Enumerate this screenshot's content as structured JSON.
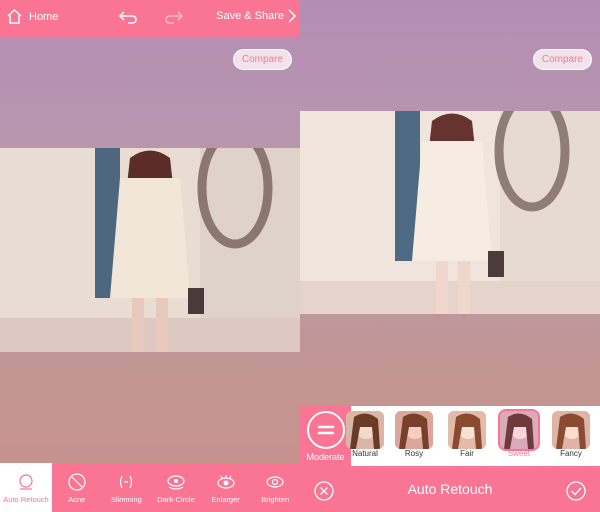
{
  "left": {
    "topbar": {
      "home_label": "Home",
      "share_label": "Save & Share"
    },
    "compare_label": "Compare",
    "toolbar": {
      "items": [
        {
          "label": "Auto Retouch",
          "icon": "auto-retouch-icon",
          "active": true
        },
        {
          "label": "Acne",
          "icon": "acne-icon"
        },
        {
          "label": "Slimming",
          "icon": "slimming-icon"
        },
        {
          "label": "Dark-Circle",
          "icon": "dark-circle-icon"
        },
        {
          "label": "Enlarger",
          "icon": "eye-enlarger-icon"
        },
        {
          "label": "Brighten",
          "icon": "brighten-eye-icon"
        }
      ]
    }
  },
  "right": {
    "compare_label": "Compare",
    "level": {
      "label": "Moderate"
    },
    "filters": [
      {
        "label": "Natural"
      },
      {
        "label": "Rosy"
      },
      {
        "label": "Fair"
      },
      {
        "label": "Sweet",
        "selected": true
      },
      {
        "label": "Fancy"
      }
    ],
    "bottom": {
      "title": "Auto Retouch"
    }
  },
  "colors": {
    "accent": "#f97593",
    "background_top": "#b48db5",
    "background_bottom": "#c9908c"
  }
}
